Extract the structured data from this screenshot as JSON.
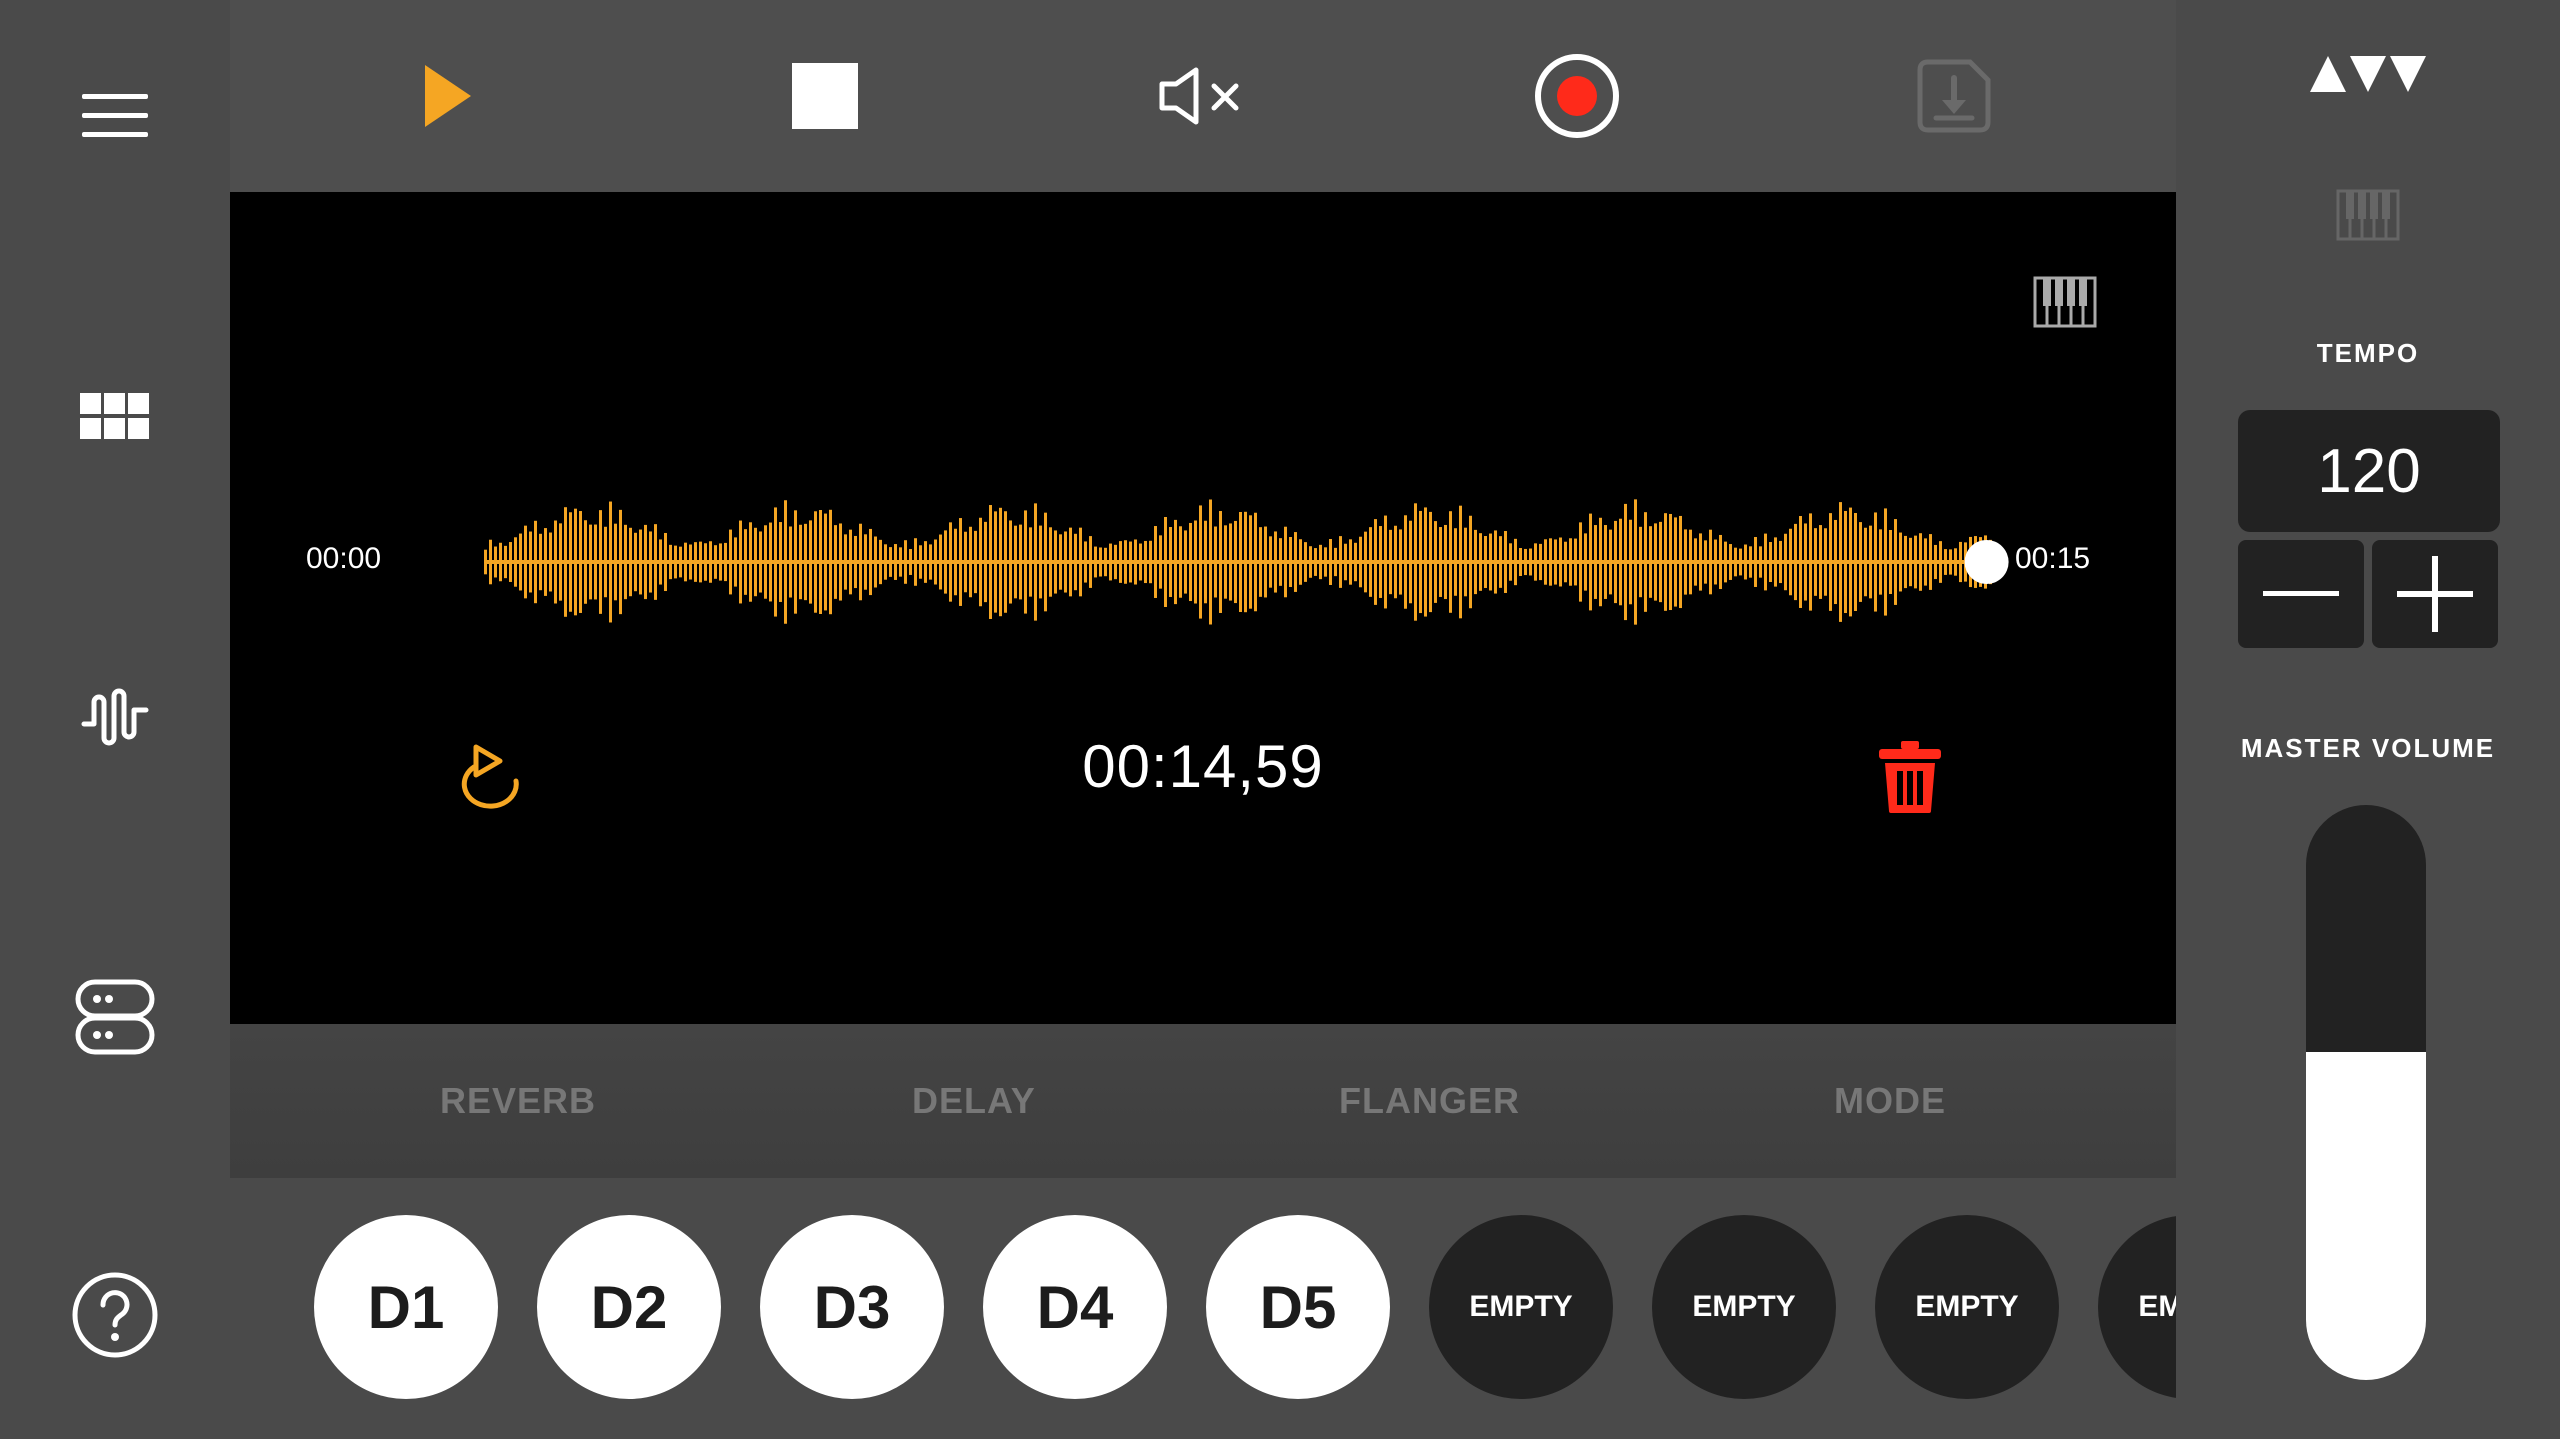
{
  "toolbar": {
    "play_icon": "play-icon",
    "stop_icon": "stop-icon",
    "mute_icon": "speaker-mute-icon",
    "record_icon": "record-icon",
    "save_icon": "download-icon"
  },
  "sidebar": {
    "items": [
      "menu-icon",
      "grid-icon",
      "waveform-icon",
      "switch-icon",
      "help-icon"
    ]
  },
  "display": {
    "time_start": "00:00",
    "time_end": "00:15",
    "counter": "00:14,59",
    "playhead_fraction": 0.972
  },
  "effects": {
    "tabs": [
      "REVERB",
      "DELAY",
      "FLANGER",
      "MODE"
    ]
  },
  "pads": [
    {
      "label": "D1",
      "state": "filled"
    },
    {
      "label": "D2",
      "state": "filled"
    },
    {
      "label": "D3",
      "state": "filled"
    },
    {
      "label": "D4",
      "state": "filled"
    },
    {
      "label": "D5",
      "state": "filled"
    },
    {
      "label": "EMPTY",
      "state": "empty"
    },
    {
      "label": "EMPTY",
      "state": "empty"
    },
    {
      "label": "EMPTY",
      "state": "empty"
    },
    {
      "label": "EMPTY",
      "state": "empty"
    }
  ],
  "right": {
    "tempo_label": "TEMPO",
    "tempo_value": "120",
    "master_volume_label": "MASTER VOLUME",
    "master_volume_fraction": 0.57
  },
  "colors": {
    "accent_orange": "#f5a623",
    "record_red": "#ff2a1a",
    "trash_red": "#ff2a1a"
  }
}
